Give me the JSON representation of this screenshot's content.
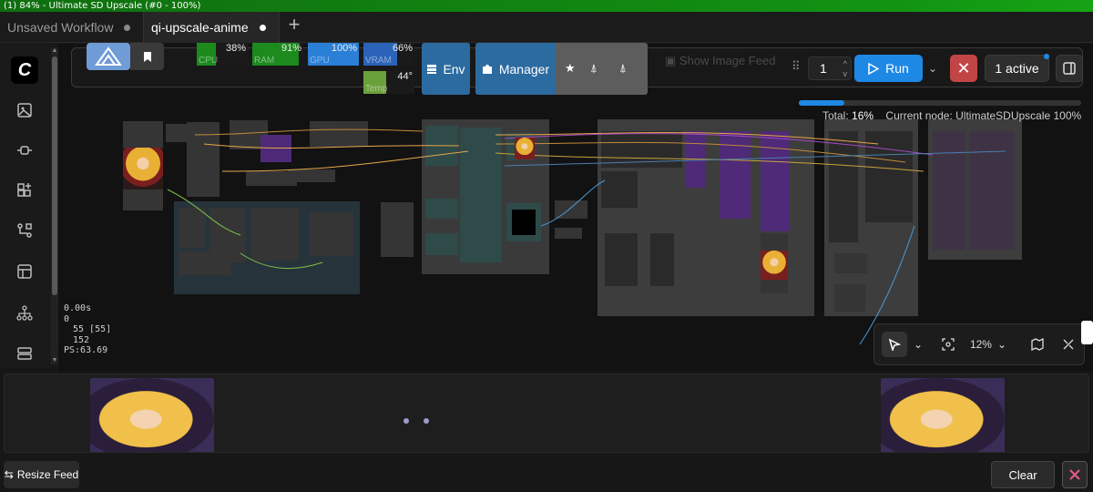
{
  "window": {
    "title": "(1) 84% - Ultimate SD Upscale (#0 - 100%)"
  },
  "tabs": [
    {
      "label": "Unsaved Workflow"
    },
    {
      "label": "qi-upscale-anime"
    }
  ],
  "sidebar": {
    "icons": [
      "logo-icon",
      "images-icon",
      "plug-icon",
      "sparkles-icon",
      "workflow-icon",
      "template-icon",
      "tree-icon",
      "queue-icon"
    ]
  },
  "stats": {
    "lines": [
      "0.00s",
      "0",
      "55 [55]",
      "152",
      "PS:63.69"
    ]
  },
  "meters": {
    "cpu": {
      "label": "CPU",
      "value": "38%",
      "level": 0.38,
      "color": "#1c8a1c"
    },
    "ram": {
      "label": "RAM",
      "value": "91%",
      "level": 0.91,
      "color": "#1c8a1c"
    },
    "gpu": {
      "label": "GPU",
      "value": "100%",
      "level": 1.0,
      "color": "#2a7fd6"
    },
    "vram": {
      "label": "VRAM",
      "value": "66%",
      "level": 0.66,
      "color": "#2a63b8"
    },
    "temp": {
      "label": "Temp",
      "value": "44°",
      "level": 0.44,
      "color": "#6aa03a"
    }
  },
  "menu": {
    "env_label": "Env",
    "manager_label": "Manager",
    "show_feed_label": "Show Image Feed",
    "queue_count": "1",
    "run_label": "Run",
    "active_label": "1 active"
  },
  "progress": {
    "value": 0.16,
    "total_label": "Total:",
    "total_value": "16%",
    "current_label": "Current node:",
    "current_value": "UltimateSDUpscale 100%"
  },
  "zoom": {
    "level": "12%"
  },
  "feed": {
    "resize_label": "Resize Feed",
    "clear_label": "Clear"
  },
  "colors": {
    "accent": "#1e88e5",
    "stop": "#c24545",
    "env": "#2c6ba0",
    "titlebar": "#129212"
  }
}
